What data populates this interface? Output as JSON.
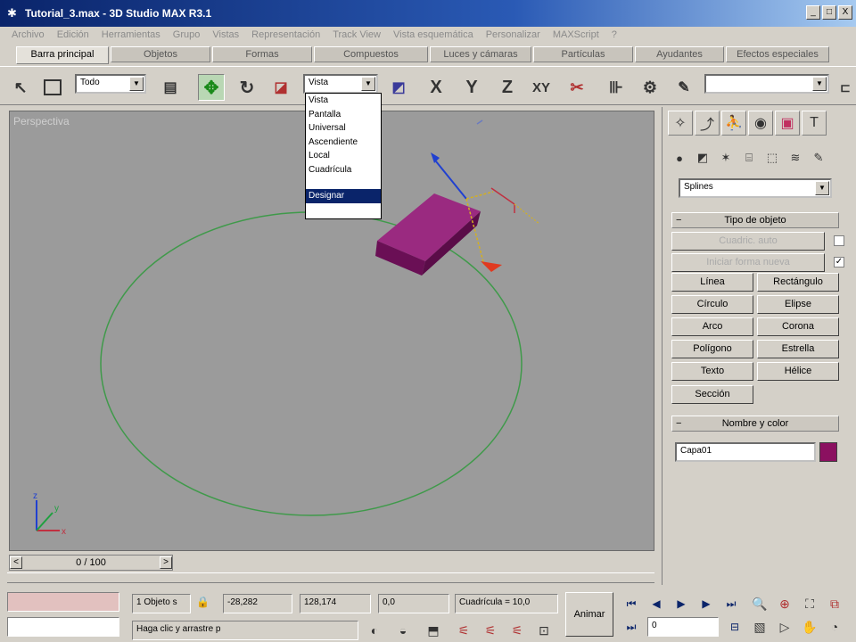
{
  "window": {
    "title": "Tutorial_3.max - 3D Studio MAX R3.1",
    "controls": [
      "_",
      "□",
      "X"
    ]
  },
  "menu": [
    "Archivo",
    "Edición",
    "Herramientas",
    "Grupo",
    "Vistas",
    "Representación",
    "Track View",
    "Vista esquemática",
    "Personalizar",
    "MAXScript",
    "?"
  ],
  "tabs": [
    "Barra principal",
    "Objetos",
    "Formas",
    "Compuestos",
    "Luces y cámaras",
    "Partículas",
    "Ayudantes",
    "Efectos especiales"
  ],
  "toolbar": {
    "filter_value": "Todo",
    "coord_value": "Vista",
    "axis_x": "X",
    "axis_y": "Y",
    "axis_z": "Z",
    "axis_xy": "XY",
    "selection_set_value": ""
  },
  "coord_dropdown": {
    "options": [
      "Vista",
      "Pantalla",
      "Universal",
      "Ascendiente",
      "Local",
      "Cuadrícula",
      "",
      "Designar"
    ],
    "selected_index": 7
  },
  "viewport": {
    "label": "Perspectiva"
  },
  "command_panel": {
    "category_value": "Splines",
    "rollup_object_type": "Tipo de objeto",
    "autogrid_label": "Cuadric. auto",
    "start_new_shape_label": "Iniciar forma nueva",
    "buttons": [
      "Línea",
      "Rectángulo",
      "Círculo",
      "Elipse",
      "Arco",
      "Corona",
      "Polígono",
      "Estrella",
      "Texto",
      "Hélice",
      "Sección"
    ],
    "rollup_name_color": "Nombre y color",
    "object_name": "Capa01",
    "object_color": "#8b1060"
  },
  "timeline": {
    "frame": "0 / 100"
  },
  "status": {
    "selection": "1 Objeto s",
    "x": "-28,282",
    "y": "128,174",
    "z": "0,0",
    "grid": "Cuadrícula = 10,0",
    "prompt": "Haga clic y arrastre p",
    "animate_label": "Animar",
    "frame_field": "0"
  },
  "colors": {
    "title_bar": "#0a246a",
    "viewport_bg": "#9b9b9b",
    "circle": "#3f9a4a",
    "box": "#7d1a6a",
    "selection_highlight": "#0a246a"
  }
}
